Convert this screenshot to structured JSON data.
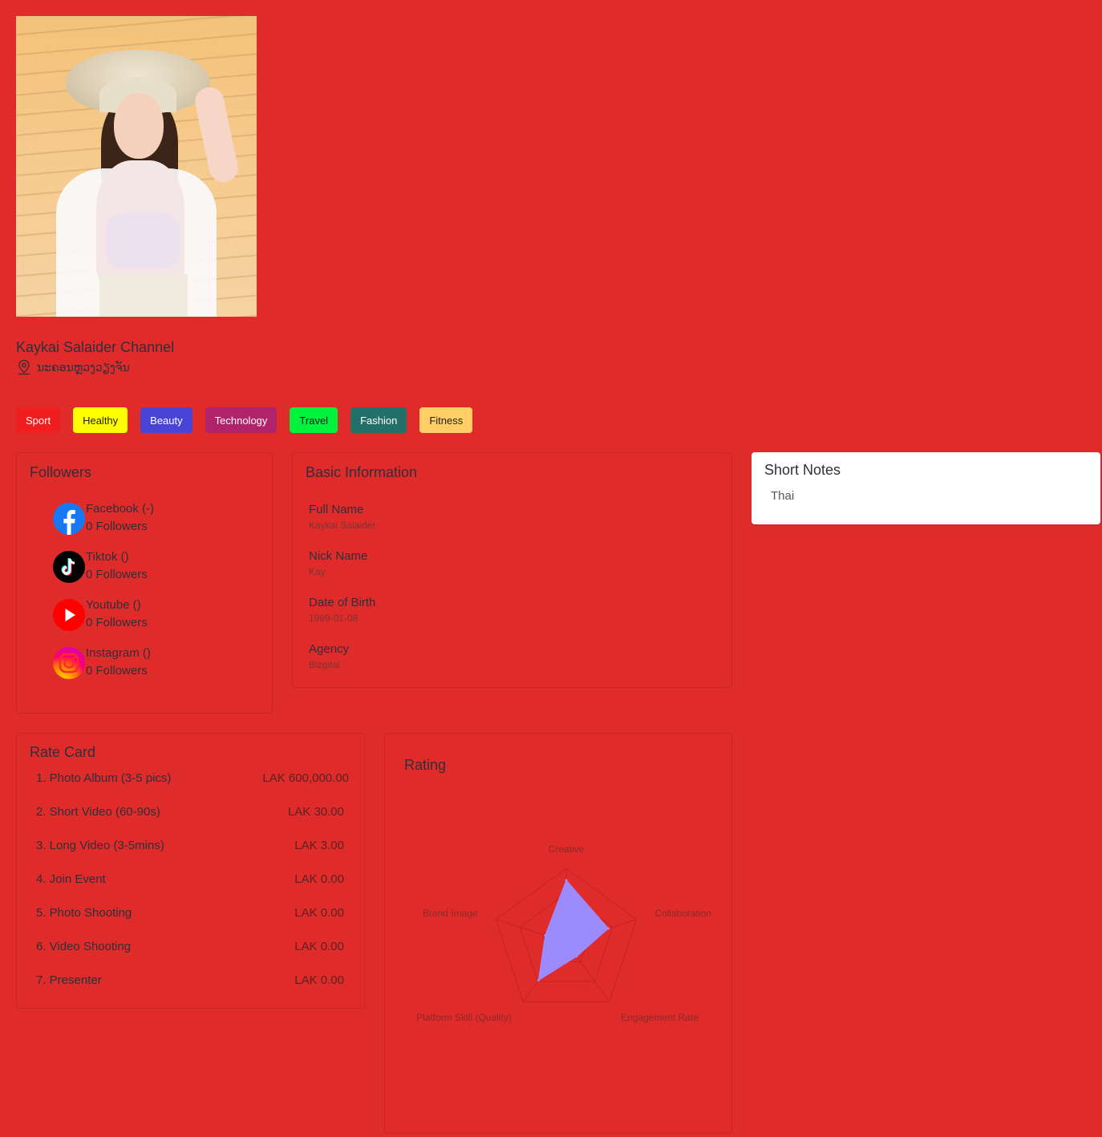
{
  "profile": {
    "channel_name": "Kaykai Salaider Channel",
    "location": "ນະຄອນຫຼວງວຽງຈັນ"
  },
  "tags": [
    {
      "label": "Sport",
      "bg": "#f01e1e",
      "fg": "#ffffff"
    },
    {
      "label": "Healthy",
      "bg": "#ffff00",
      "fg": "#222222"
    },
    {
      "label": "Beauty",
      "bg": "#4a44d6",
      "fg": "#ffffff"
    },
    {
      "label": "Technology",
      "bg": "#b0236a",
      "fg": "#ffffff"
    },
    {
      "label": "Travel",
      "bg": "#00f23c",
      "fg": "#1a1a1a"
    },
    {
      "label": "Fashion",
      "bg": "#23706a",
      "fg": "#ffffff"
    },
    {
      "label": "Fitness",
      "bg": "#ffcf66",
      "fg": "#222222"
    }
  ],
  "followers": {
    "title": "Followers",
    "items": [
      {
        "name": "Facebook (-)",
        "count": "0 Followers",
        "icon": "facebook-icon"
      },
      {
        "name": "Tiktok ()",
        "count": "0 Followers",
        "icon": "tiktok-icon"
      },
      {
        "name": "Youtube ()",
        "count": "0 Followers",
        "icon": "youtube-icon"
      },
      {
        "name": "Instagram ()",
        "count": "0 Followers",
        "icon": "instagram-icon"
      }
    ]
  },
  "basic_info": {
    "title": "Basic Information",
    "fields": [
      {
        "label": "Full Name",
        "value": "Kaykai Salaider"
      },
      {
        "label": "Nick Name",
        "value": "Kay"
      },
      {
        "label": "Date of Birth",
        "value": "1999-01-08"
      },
      {
        "label": "Agency",
        "value": "Bizgital"
      }
    ]
  },
  "short_notes": {
    "title": "Short Notes",
    "text": "Thai"
  },
  "rate_card": {
    "title": "Rate Card",
    "items": [
      {
        "label": "1. Photo Album (3-5 pics)",
        "price": "LAK 600,000.00"
      },
      {
        "label": "2. Short Video (60-90s)",
        "price": "LAK 30.00"
      },
      {
        "label": "3. Long Video (3-5mins)",
        "price": "LAK 3.00"
      },
      {
        "label": "4. Join Event",
        "price": "LAK 0.00"
      },
      {
        "label": "5. Photo Shooting",
        "price": "LAK 0.00"
      },
      {
        "label": "6. Video Shooting",
        "price": "LAK 0.00"
      },
      {
        "label": "7. Presenter",
        "price": "LAK 0.00"
      }
    ]
  },
  "rating": {
    "title": "Rating"
  },
  "chart_data": {
    "type": "radar",
    "categories": [
      "Creative",
      "Collaboration",
      "Engagement Rate",
      "Platform Skill (Quality)",
      "Brand Image"
    ],
    "values": [
      4.2,
      3.0,
      1.2,
      3.2,
      1.5
    ],
    "max": 5,
    "fill_color": "#9b8bff"
  }
}
